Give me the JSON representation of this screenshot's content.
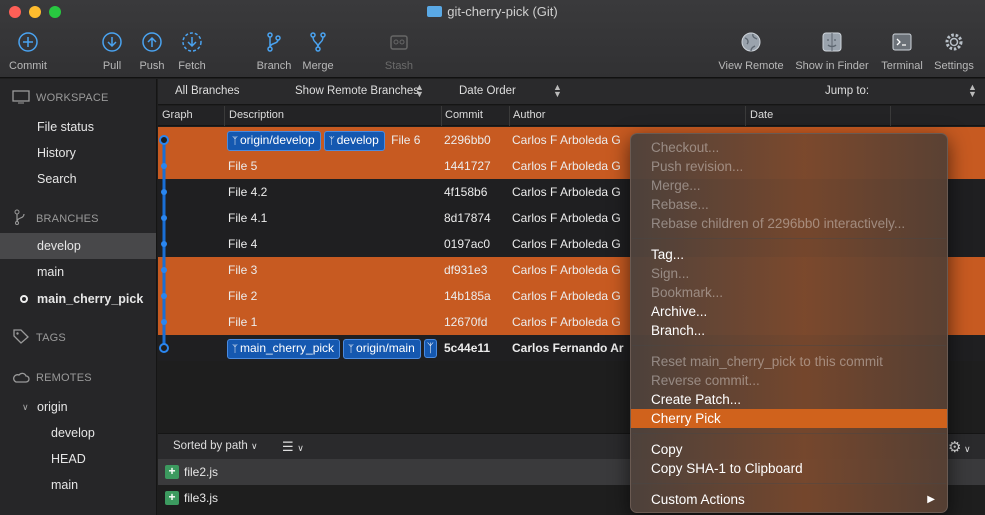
{
  "window": {
    "title": "git-cherry-pick (Git)"
  },
  "toolbar": {
    "commit": "Commit",
    "pull": "Pull",
    "push": "Push",
    "fetch": "Fetch",
    "branch": "Branch",
    "merge": "Merge",
    "stash": "Stash",
    "view_remote": "View Remote",
    "show_in_finder": "Show in Finder",
    "terminal": "Terminal",
    "settings": "Settings"
  },
  "sidebar": {
    "workspace": "WORKSPACE",
    "workspace_items": [
      "File status",
      "History",
      "Search"
    ],
    "branches": "BRANCHES",
    "branch_items": [
      "develop",
      "main",
      "main_cherry_pick"
    ],
    "tags": "TAGS",
    "remotes": "REMOTES",
    "remote_name": "origin",
    "remote_items": [
      "develop",
      "HEAD",
      "main"
    ]
  },
  "filters": {
    "branches": "All Branches",
    "remote": "Show Remote Branches",
    "order": "Date Order",
    "jump": "Jump to:"
  },
  "columns": {
    "graph": "Graph",
    "description": "Description",
    "commit": "Commit",
    "author": "Author",
    "date": "Date"
  },
  "commits": [
    {
      "tags": [
        "origin/develop",
        "develop"
      ],
      "desc": "File 6",
      "hash": "2296bb0",
      "author": "Carlos F Arboleda G"
    },
    {
      "tags": [],
      "desc": "File 5",
      "hash": "1441727",
      "author": "Carlos F Arboleda G"
    },
    {
      "tags": [],
      "desc": "File 4.2",
      "hash": "4f158b6",
      "author": "Carlos F Arboleda G"
    },
    {
      "tags": [],
      "desc": "File 4.1",
      "hash": "8d17874",
      "author": "Carlos F Arboleda G"
    },
    {
      "tags": [],
      "desc": "File 4",
      "hash": "0197ac0",
      "author": "Carlos F Arboleda G"
    },
    {
      "tags": [],
      "desc": "File 3",
      "hash": "df931e3",
      "author": "Carlos F Arboleda G"
    },
    {
      "tags": [],
      "desc": "File 2",
      "hash": "14b185a",
      "author": "Carlos F Arboleda G"
    },
    {
      "tags": [],
      "desc": "File 1",
      "hash": "12670fd",
      "author": "Carlos F Arboleda G"
    },
    {
      "tags": [
        "main_cherry_pick",
        "origin/main"
      ],
      "desc": "",
      "hash": "5c44e11",
      "author": "Carlos Fernando Ar"
    }
  ],
  "bottom": {
    "sort": "Sorted by path",
    "files": [
      "file2.js",
      "file3.js"
    ]
  },
  "context_menu": {
    "group1": [
      "Checkout...",
      "Push revision...",
      "Merge...",
      "Rebase...",
      "Rebase children of 2296bb0 interactively..."
    ],
    "group2": [
      "Tag...",
      "Sign...",
      "Bookmark...",
      "Archive...",
      "Branch..."
    ],
    "group3": [
      "Reset main_cherry_pick to this commit",
      "Reverse commit...",
      "Create Patch...",
      "Cherry Pick"
    ],
    "group4": [
      "Copy",
      "Copy SHA-1 to Clipboard"
    ],
    "group5": [
      "Custom Actions"
    ]
  },
  "colors": {
    "accent": "#c75a21",
    "branch_tag": "#1558b0",
    "graph_line": "#1a6fd6"
  }
}
